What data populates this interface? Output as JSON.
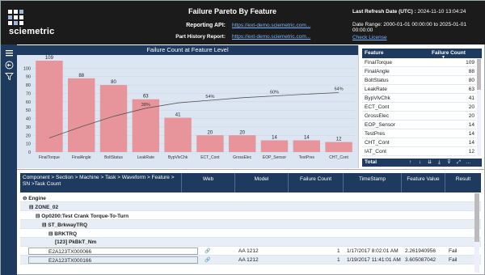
{
  "header": {
    "logo_text": "sciemetric",
    "title": "Failure Pareto By Feature",
    "reporting_api_label": "Reporting API:",
    "reporting_api_link": "https://ext-demo.sciemetric.com...",
    "part_history_label": "Part History Report:",
    "part_history_link": "https://ext-demo.sciemetric.com...",
    "refresh_label": "Last Refresh Date (UTC) :",
    "refresh_value": "2024-11-10 13:04:24",
    "date_range": "Date Range: 2000-01-01 00:00:00 to 2025-01-01 00:00:00",
    "check_license": "Check License"
  },
  "rail": {
    "icons": [
      "menu-icon",
      "back-arrow-icon",
      "filter-icon"
    ]
  },
  "chart_data": {
    "type": "bar",
    "title": "Failure Count at Feature Level",
    "categories": [
      "FinalTorque",
      "FinalAngle",
      "BoltStatus",
      "LeakRate",
      "BypVlvChk",
      "ECT_Cont",
      "GrossElec",
      "EOP_Sensor",
      "TestPres",
      "CHT_Cont"
    ],
    "values": [
      109,
      88,
      80,
      63,
      41,
      20,
      20,
      14,
      14,
      12
    ],
    "ylim": [
      0,
      110
    ],
    "yticks": [
      0,
      10,
      20,
      30,
      40,
      50,
      60,
      70,
      80,
      90,
      100
    ],
    "cumulative_line": true,
    "cumulative_labels": [
      {
        "category_index": 3,
        "text": "38%"
      },
      {
        "category_index": 5,
        "text": "54%"
      },
      {
        "category_index": 7,
        "text": "60%"
      },
      {
        "category_index": 9,
        "text": "64%"
      }
    ],
    "bar_color": "#e8949b",
    "line_color": "#555555",
    "grid": true
  },
  "feature_table": {
    "col_feature": "Feature",
    "col_count": "Failure Count",
    "rows": [
      {
        "feature": "FinalTorque",
        "count": "109"
      },
      {
        "feature": "FinalAngle",
        "count": "88"
      },
      {
        "feature": "BoltStatus",
        "count": "80"
      },
      {
        "feature": "LeakRate",
        "count": "63"
      },
      {
        "feature": "BypVlvChk",
        "count": "41"
      },
      {
        "feature": "ECT_Cont",
        "count": "20"
      },
      {
        "feature": "GrossElec",
        "count": "20"
      },
      {
        "feature": "EOP_Sensor",
        "count": "14"
      },
      {
        "feature": "TestPres",
        "count": "14"
      },
      {
        "feature": "CHT_Cont",
        "count": "14"
      },
      {
        "feature": "IAT_Cont",
        "count": "12"
      }
    ],
    "total_label": "Total"
  },
  "tree_table": {
    "headers": {
      "path": "Component > Section > Machine > Task > Waveform > Feature > SN >Task Count",
      "web": "Web",
      "model": "Model",
      "failure_count": "Failure Count",
      "timestamp": "TimeStamp",
      "feature_value": "Feature Value",
      "result": "Result"
    },
    "rows": [
      {
        "label": "⊖ Engine",
        "indent": 0
      },
      {
        "label": "⊟ ZONE_02",
        "indent": 1
      },
      {
        "label": "⊟ Op0200:Test Crank Torque-To-Turn",
        "indent": 2
      },
      {
        "label": "⊟ ST_BrkwayTRQ",
        "indent": 3
      },
      {
        "label": "⊟ BRKTRQ",
        "indent": 4
      },
      {
        "label": "[123] PkBkT_Nm",
        "indent": 5
      }
    ],
    "leaf_rows": [
      {
        "sn": "E2A123TX000066",
        "model": "AA 1212",
        "count": "1",
        "timestamp": "1/17/2017 8:02:01 AM",
        "value": "2.261940956",
        "result": "Fail"
      },
      {
        "sn": "E2A123TX000166",
        "model": "AA 1212",
        "count": "1",
        "timestamp": "1/19/2017 11:41:01 AM",
        "value": "3.605087042",
        "result": "Fail"
      }
    ]
  }
}
